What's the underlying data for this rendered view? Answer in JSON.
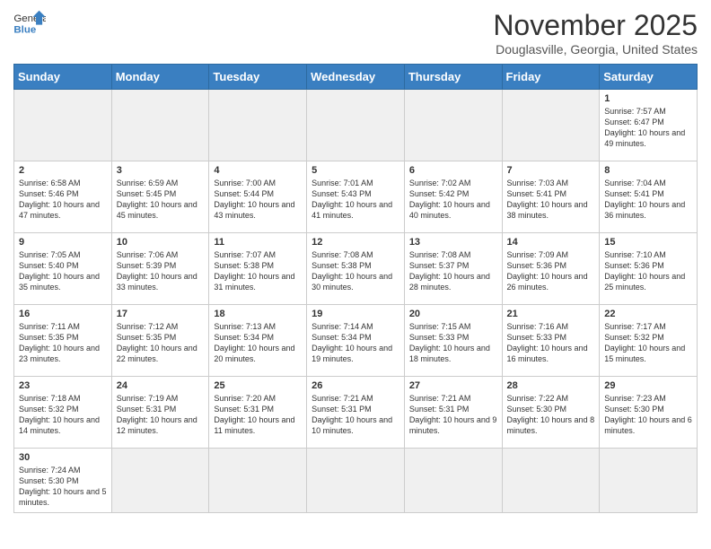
{
  "header": {
    "logo_general": "General",
    "logo_blue": "Blue",
    "month_title": "November 2025",
    "location": "Douglasville, Georgia, United States"
  },
  "days_of_week": [
    "Sunday",
    "Monday",
    "Tuesday",
    "Wednesday",
    "Thursday",
    "Friday",
    "Saturday"
  ],
  "weeks": [
    [
      {
        "day": null,
        "info": null
      },
      {
        "day": null,
        "info": null
      },
      {
        "day": null,
        "info": null
      },
      {
        "day": null,
        "info": null
      },
      {
        "day": null,
        "info": null
      },
      {
        "day": null,
        "info": null
      },
      {
        "day": "1",
        "info": "Sunrise: 7:57 AM\nSunset: 6:47 PM\nDaylight: 10 hours and 49 minutes."
      }
    ],
    [
      {
        "day": "2",
        "info": "Sunrise: 6:58 AM\nSunset: 5:46 PM\nDaylight: 10 hours and 47 minutes."
      },
      {
        "day": "3",
        "info": "Sunrise: 6:59 AM\nSunset: 5:45 PM\nDaylight: 10 hours and 45 minutes."
      },
      {
        "day": "4",
        "info": "Sunrise: 7:00 AM\nSunset: 5:44 PM\nDaylight: 10 hours and 43 minutes."
      },
      {
        "day": "5",
        "info": "Sunrise: 7:01 AM\nSunset: 5:43 PM\nDaylight: 10 hours and 41 minutes."
      },
      {
        "day": "6",
        "info": "Sunrise: 7:02 AM\nSunset: 5:42 PM\nDaylight: 10 hours and 40 minutes."
      },
      {
        "day": "7",
        "info": "Sunrise: 7:03 AM\nSunset: 5:41 PM\nDaylight: 10 hours and 38 minutes."
      },
      {
        "day": "8",
        "info": "Sunrise: 7:04 AM\nSunset: 5:41 PM\nDaylight: 10 hours and 36 minutes."
      }
    ],
    [
      {
        "day": "9",
        "info": "Sunrise: 7:05 AM\nSunset: 5:40 PM\nDaylight: 10 hours and 35 minutes."
      },
      {
        "day": "10",
        "info": "Sunrise: 7:06 AM\nSunset: 5:39 PM\nDaylight: 10 hours and 33 minutes."
      },
      {
        "day": "11",
        "info": "Sunrise: 7:07 AM\nSunset: 5:38 PM\nDaylight: 10 hours and 31 minutes."
      },
      {
        "day": "12",
        "info": "Sunrise: 7:08 AM\nSunset: 5:38 PM\nDaylight: 10 hours and 30 minutes."
      },
      {
        "day": "13",
        "info": "Sunrise: 7:08 AM\nSunset: 5:37 PM\nDaylight: 10 hours and 28 minutes."
      },
      {
        "day": "14",
        "info": "Sunrise: 7:09 AM\nSunset: 5:36 PM\nDaylight: 10 hours and 26 minutes."
      },
      {
        "day": "15",
        "info": "Sunrise: 7:10 AM\nSunset: 5:36 PM\nDaylight: 10 hours and 25 minutes."
      }
    ],
    [
      {
        "day": "16",
        "info": "Sunrise: 7:11 AM\nSunset: 5:35 PM\nDaylight: 10 hours and 23 minutes."
      },
      {
        "day": "17",
        "info": "Sunrise: 7:12 AM\nSunset: 5:35 PM\nDaylight: 10 hours and 22 minutes."
      },
      {
        "day": "18",
        "info": "Sunrise: 7:13 AM\nSunset: 5:34 PM\nDaylight: 10 hours and 20 minutes."
      },
      {
        "day": "19",
        "info": "Sunrise: 7:14 AM\nSunset: 5:34 PM\nDaylight: 10 hours and 19 minutes."
      },
      {
        "day": "20",
        "info": "Sunrise: 7:15 AM\nSunset: 5:33 PM\nDaylight: 10 hours and 18 minutes."
      },
      {
        "day": "21",
        "info": "Sunrise: 7:16 AM\nSunset: 5:33 PM\nDaylight: 10 hours and 16 minutes."
      },
      {
        "day": "22",
        "info": "Sunrise: 7:17 AM\nSunset: 5:32 PM\nDaylight: 10 hours and 15 minutes."
      }
    ],
    [
      {
        "day": "23",
        "info": "Sunrise: 7:18 AM\nSunset: 5:32 PM\nDaylight: 10 hours and 14 minutes."
      },
      {
        "day": "24",
        "info": "Sunrise: 7:19 AM\nSunset: 5:31 PM\nDaylight: 10 hours and 12 minutes."
      },
      {
        "day": "25",
        "info": "Sunrise: 7:20 AM\nSunset: 5:31 PM\nDaylight: 10 hours and 11 minutes."
      },
      {
        "day": "26",
        "info": "Sunrise: 7:21 AM\nSunset: 5:31 PM\nDaylight: 10 hours and 10 minutes."
      },
      {
        "day": "27",
        "info": "Sunrise: 7:21 AM\nSunset: 5:31 PM\nDaylight: 10 hours and 9 minutes."
      },
      {
        "day": "28",
        "info": "Sunrise: 7:22 AM\nSunset: 5:30 PM\nDaylight: 10 hours and 8 minutes."
      },
      {
        "day": "29",
        "info": "Sunrise: 7:23 AM\nSunset: 5:30 PM\nDaylight: 10 hours and 6 minutes."
      }
    ],
    [
      {
        "day": "30",
        "info": "Sunrise: 7:24 AM\nSunset: 5:30 PM\nDaylight: 10 hours and 5 minutes."
      },
      {
        "day": null,
        "info": null
      },
      {
        "day": null,
        "info": null
      },
      {
        "day": null,
        "info": null
      },
      {
        "day": null,
        "info": null
      },
      {
        "day": null,
        "info": null
      },
      {
        "day": null,
        "info": null
      }
    ]
  ]
}
